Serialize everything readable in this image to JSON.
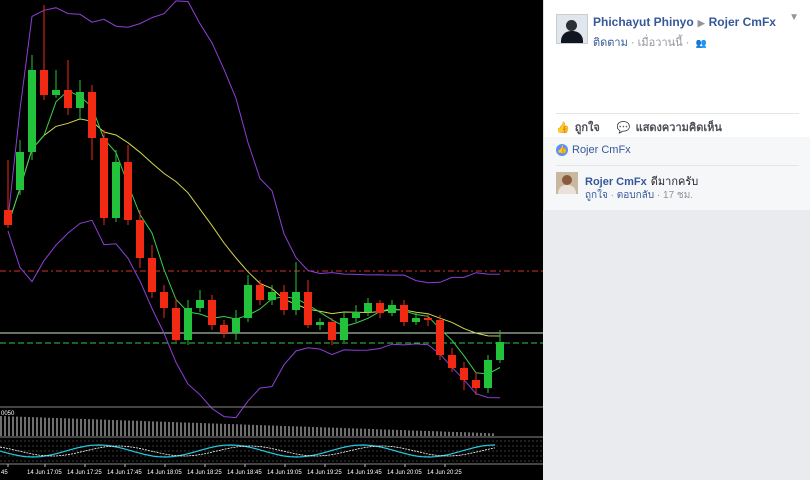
{
  "post": {
    "author": "Phichayut Phinyo",
    "target": "Rojer CmFx",
    "follow": "ติดตาม",
    "time": "เมื่อวานนี้"
  },
  "actions": {
    "like": "ถูกใจ",
    "comment": "แสดงความคิดเห็น"
  },
  "likes": {
    "liker": "Rojer CmFx"
  },
  "comment": {
    "author": "Rojer CmFx",
    "text": "ดีมากครับ",
    "like": "ถูกใจ",
    "reply": "ตอบกลับ",
    "time": "17 ชม."
  },
  "chart": {
    "indicator_label": "0050",
    "time_labels": [
      "45",
      "14 Jun 17:05",
      "14 Jun 17:25",
      "14 Jun 17:45",
      "14 Jun 18:05",
      "14 Jun 18:25",
      "14 Jun 18:45",
      "14 Jun 19:05",
      "14 Jun 19:25",
      "14 Jun 19:45",
      "14 Jun 20:05",
      "14 Jun 20:25"
    ],
    "colors": {
      "bull": "#22c33a",
      "bear": "#f22a14",
      "band": "#8f3fd8",
      "ma_fast": "#3ad24a",
      "ma_slow": "#d8d64a",
      "level_red": "#d9312a",
      "level_white": "#cfe6cf",
      "level_green": "#32c84a"
    }
  },
  "chart_data": {
    "type": "candlestick",
    "candles": [
      {
        "o": 210,
        "c": 225,
        "h": 160,
        "l": 228
      },
      {
        "o": 190,
        "c": 152,
        "h": 140,
        "l": 195
      },
      {
        "o": 152,
        "c": 70,
        "h": 55,
        "l": 160
      },
      {
        "o": 70,
        "c": 95,
        "h": 5,
        "l": 100
      },
      {
        "o": 95,
        "c": 90,
        "h": 70,
        "l": 98
      },
      {
        "o": 90,
        "c": 108,
        "h": 60,
        "l": 115
      },
      {
        "o": 108,
        "c": 92,
        "h": 80,
        "l": 120
      },
      {
        "o": 92,
        "c": 138,
        "h": 85,
        "l": 160
      },
      {
        "o": 138,
        "c": 218,
        "h": 130,
        "l": 225
      },
      {
        "o": 218,
        "c": 162,
        "h": 150,
        "l": 222
      },
      {
        "o": 162,
        "c": 220,
        "h": 145,
        "l": 225
      },
      {
        "o": 220,
        "c": 258,
        "h": 210,
        "l": 268
      },
      {
        "o": 258,
        "c": 292,
        "h": 245,
        "l": 298
      },
      {
        "o": 292,
        "c": 308,
        "h": 285,
        "l": 318
      },
      {
        "o": 308,
        "c": 340,
        "h": 298,
        "l": 342
      },
      {
        "o": 340,
        "c": 308,
        "h": 300,
        "l": 345
      },
      {
        "o": 308,
        "c": 300,
        "h": 290,
        "l": 312
      },
      {
        "o": 300,
        "c": 325,
        "h": 295,
        "l": 330
      },
      {
        "o": 325,
        "c": 333,
        "h": 320,
        "l": 338
      },
      {
        "o": 333,
        "c": 318,
        "h": 310,
        "l": 340
      },
      {
        "o": 318,
        "c": 285,
        "h": 275,
        "l": 322
      },
      {
        "o": 285,
        "c": 300,
        "h": 280,
        "l": 305
      },
      {
        "o": 300,
        "c": 292,
        "h": 285,
        "l": 305
      },
      {
        "o": 292,
        "c": 310,
        "h": 285,
        "l": 315
      },
      {
        "o": 310,
        "c": 292,
        "h": 262,
        "l": 315
      },
      {
        "o": 292,
        "c": 325,
        "h": 280,
        "l": 328
      },
      {
        "o": 325,
        "c": 322,
        "h": 318,
        "l": 330
      },
      {
        "o": 322,
        "c": 340,
        "h": 318,
        "l": 345
      },
      {
        "o": 340,
        "c": 318,
        "h": 312,
        "l": 342
      },
      {
        "o": 318,
        "c": 312,
        "h": 305,
        "l": 322
      },
      {
        "o": 312,
        "c": 303,
        "h": 298,
        "l": 316
      },
      {
        "o": 303,
        "c": 313,
        "h": 300,
        "l": 318
      },
      {
        "o": 313,
        "c": 305,
        "h": 300,
        "l": 316
      },
      {
        "o": 305,
        "c": 322,
        "h": 300,
        "l": 326
      },
      {
        "o": 322,
        "c": 318,
        "h": 312,
        "l": 325
      },
      {
        "o": 318,
        "c": 320,
        "h": 314,
        "l": 326
      },
      {
        "o": 320,
        "c": 355,
        "h": 315,
        "l": 360
      },
      {
        "o": 355,
        "c": 368,
        "h": 348,
        "l": 372
      },
      {
        "o": 368,
        "c": 380,
        "h": 362,
        "l": 390
      },
      {
        "o": 380,
        "c": 388,
        "h": 372,
        "l": 395
      },
      {
        "o": 388,
        "c": 360,
        "h": 355,
        "l": 393
      },
      {
        "o": 360,
        "c": 342,
        "h": 330,
        "l": 363
      }
    ]
  }
}
